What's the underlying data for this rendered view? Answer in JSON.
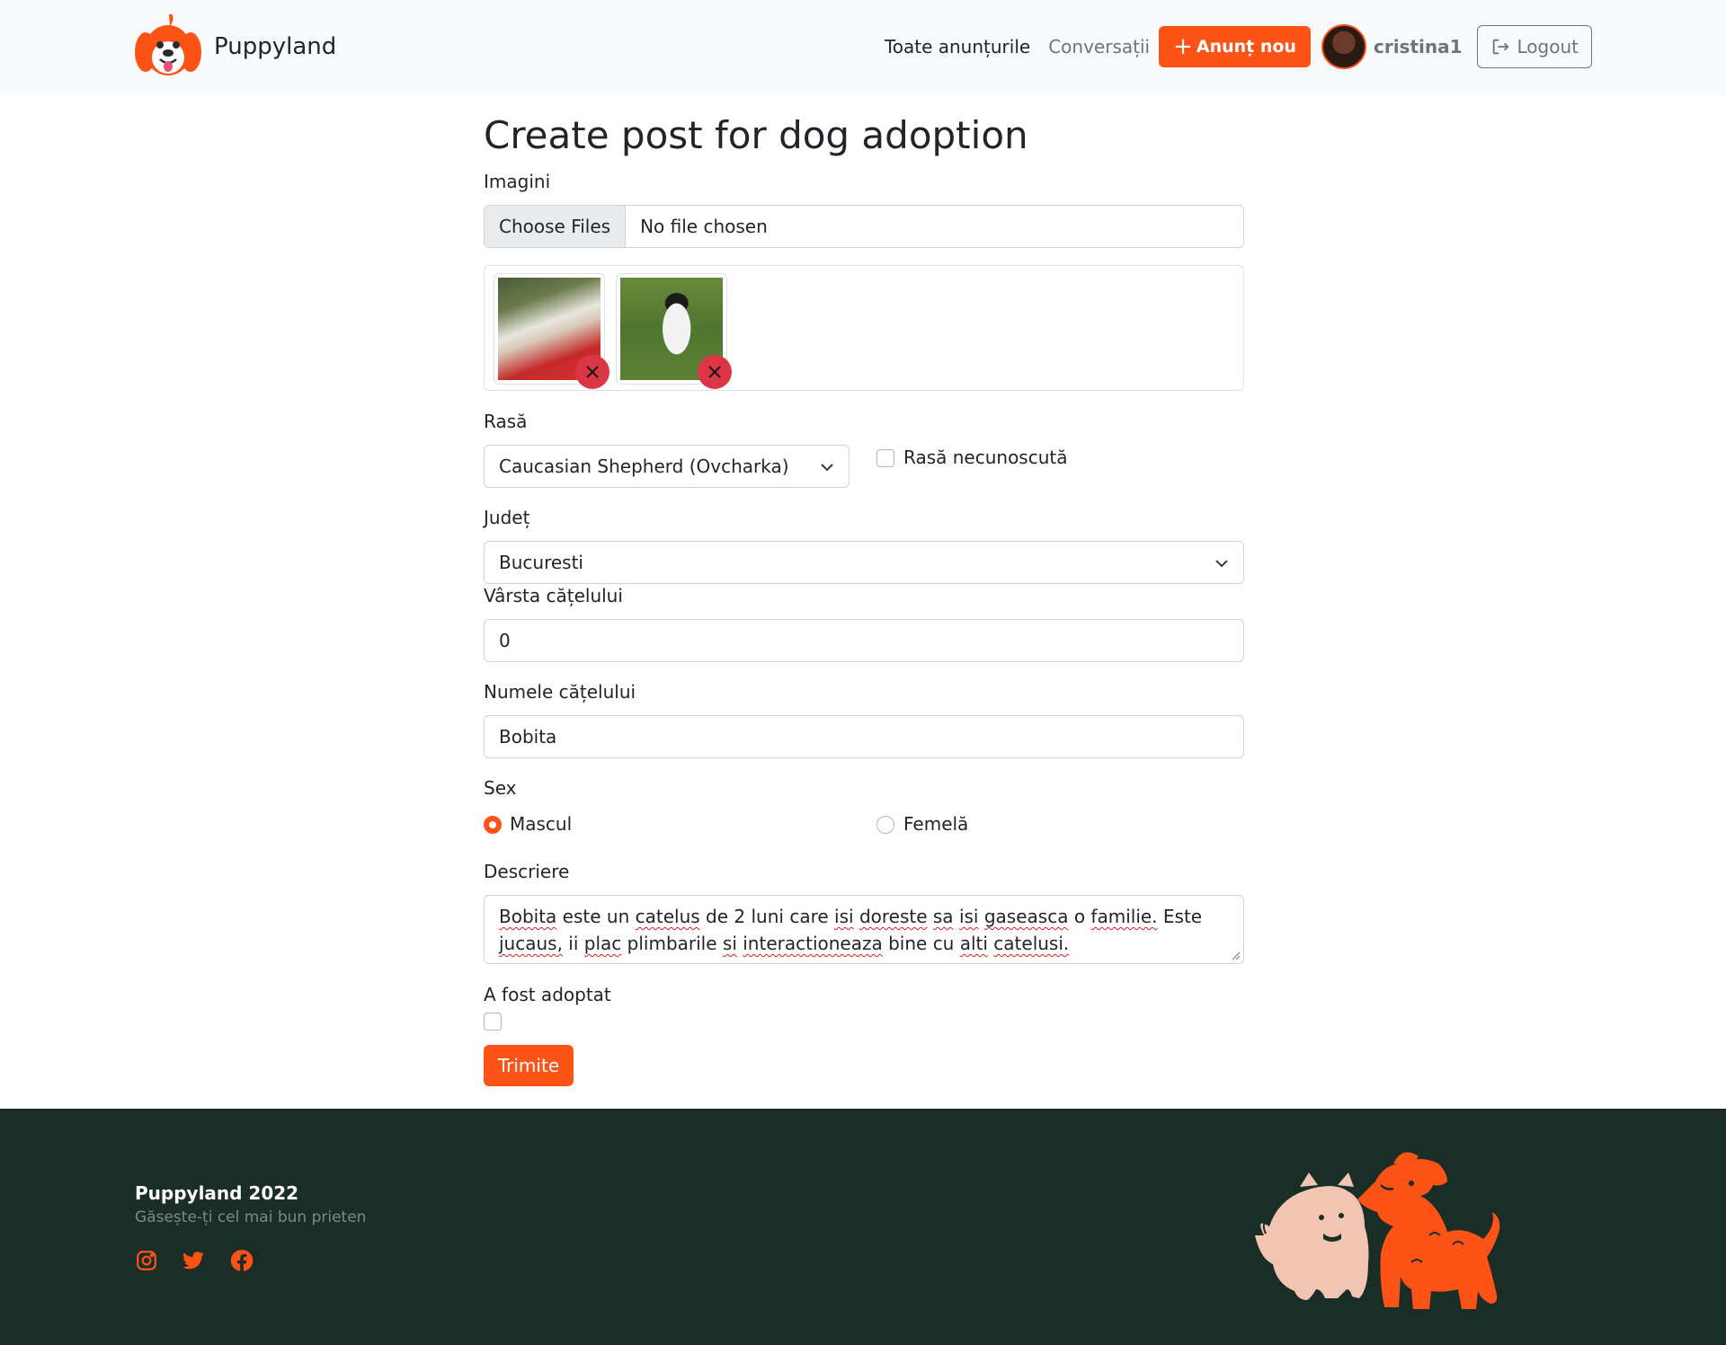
{
  "navbar": {
    "brand": "Puppyland",
    "links": {
      "all_posts": "Toate anunțurile",
      "conversations": "Conversații"
    },
    "new_post_button": "Anunț nou",
    "username": "cristina1",
    "logout_button": "Logout"
  },
  "form": {
    "title": "Create post for dog adoption",
    "images_label": "Imagini",
    "file_button": "Choose Files",
    "file_status": "No file chosen",
    "breed_label": "Rasă",
    "breed_value": "Caucasian Shepherd (Ovcharka)",
    "unknown_breed_label": "Rasă necunoscută",
    "county_label": "Județ",
    "county_value": "Bucuresti",
    "age_label": "Vârsta cățelului",
    "age_value": "0",
    "name_label": "Numele cățelului",
    "name_value": "Bobita",
    "sex_label": "Sex",
    "sex_male": "Mascul",
    "sex_female": "Femelă",
    "sex_selected": "Mascul",
    "description_label": "Descriere",
    "description_value": "Bobita este un catelus de 2 luni care isi doreste sa isi gaseasca o familie. Este jucaus, ii plac plimbarile si interactioneaza bine cu alti catelusi.",
    "adopted_label": "A fost adoptat",
    "adopted_checked": false,
    "unknown_breed_checked": false,
    "submit_button": "Trimite"
  },
  "footer": {
    "title": "Puppyland 2022",
    "subtitle": "Găsește-ți cel mai bun prieten",
    "social_icons": [
      "instagram-icon",
      "twitter-icon",
      "facebook-icon"
    ]
  },
  "colors": {
    "accent": "#fd5317",
    "footer_bg": "#1b2d27",
    "remove": "#dc3545"
  }
}
